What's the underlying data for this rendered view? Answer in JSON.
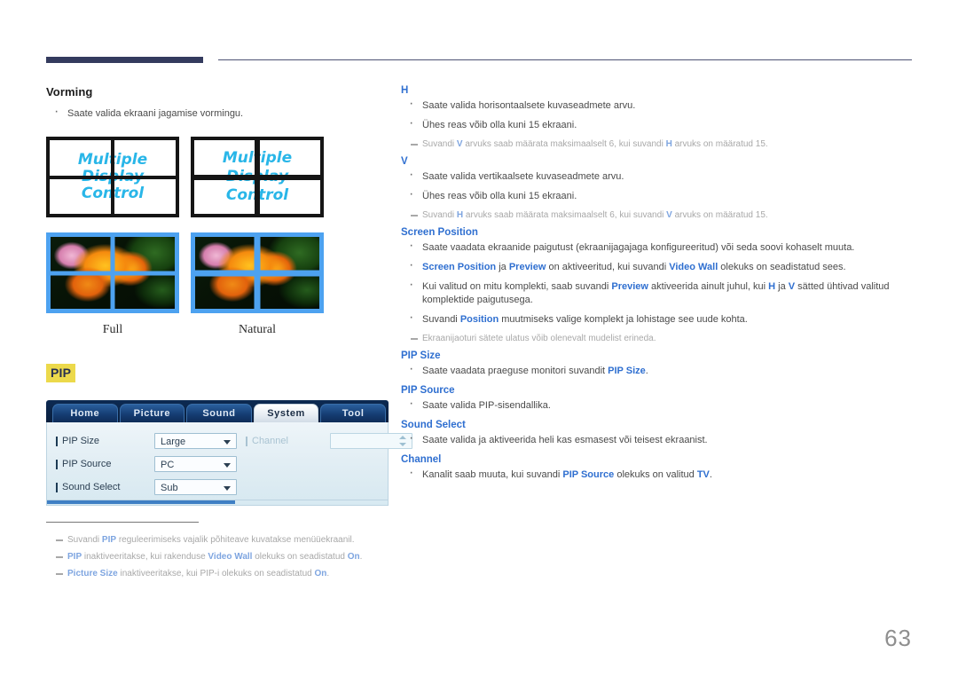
{
  "page": {
    "number": "63"
  },
  "left": {
    "vorming": {
      "heading": "Vorming",
      "bullets": [
        "Saate valida ekraani jagamise vormingu."
      ],
      "diagram": {
        "wall_text_lines": [
          "Multiple",
          "Display",
          "Control"
        ],
        "captions": [
          "Full",
          "Natural"
        ]
      }
    },
    "pip": {
      "badge": "PIP",
      "osd": {
        "tabs": [
          {
            "label": "Home",
            "active": false
          },
          {
            "label": "Picture",
            "active": false
          },
          {
            "label": "Sound",
            "active": false
          },
          {
            "label": "System",
            "active": true
          },
          {
            "label": "Tool",
            "active": false
          }
        ],
        "rows_left": [
          {
            "label": "PIP Size",
            "value": "Large"
          },
          {
            "label": "PIP Source",
            "value": "PC"
          },
          {
            "label": "Sound Select",
            "value": "Sub"
          }
        ],
        "rows_right": [
          {
            "label": "Channel",
            "value": ""
          }
        ]
      },
      "footnotes": [
        "Suvandi PIP reguleerimiseks vajalik põhiteave kuvatakse menüüekraanil.",
        "PIP inaktiveeritakse, kui rakenduse Video Wall olekuks on seadistatud On.",
        "Picture Size inaktiveeritakse, kui PIP-i olekuks on seadistatud On."
      ]
    }
  },
  "right": {
    "sections": [
      {
        "heading": "H",
        "bullets": [
          "Saate valida horisontaalsete kuvaseadmete arvu.",
          "Ühes reas võib olla kuni 15 ekraani."
        ],
        "notes": [
          "Suvandi V arvuks saab määrata maksimaalselt 6, kui suvandi H arvuks on määratud 15."
        ]
      },
      {
        "heading": "V",
        "bullets": [
          "Saate valida vertikaalsete kuvaseadmete arvu.",
          "Ühes reas võib olla kuni 15 ekraani."
        ],
        "notes": [
          "Suvandi H arvuks saab määrata maksimaalselt 6, kui suvandi V arvuks on määratud 15."
        ]
      },
      {
        "heading": "Screen Position",
        "bullets": [
          "Saate vaadata ekraanide paigutust (ekraanijagajaga konfigureeritud) või seda soovi kohaselt muuta.",
          "Screen Position ja Preview on aktiveeritud, kui suvandi Video Wall olekuks on seadistatud sees.",
          "Kui valitud on mitu komplekti, saab suvandi Preview aktiveerida ainult juhul, kui H ja V sätted ühtivad valitud komplektide paigutusega.",
          "Suvandi Position muutmiseks valige komplekt ja lohistage see uude kohta."
        ],
        "notes": [
          "Ekraanijaoturi sätete ulatus võib olenevalt mudelist erineda."
        ]
      },
      {
        "heading": "PIP Size",
        "bullets": [
          "Saate vaadata praeguse monitori suvandit PIP Size."
        ],
        "notes": []
      },
      {
        "heading": "PIP Source",
        "bullets": [
          "Saate valida PIP-sisendallika."
        ],
        "notes": []
      },
      {
        "heading": "Sound Select",
        "bullets": [
          "Saate valida ja aktiveerida heli kas esmasest või teisest ekraanist."
        ],
        "notes": []
      },
      {
        "heading": "Channel",
        "bullets": [
          "Kanalit saab muuta, kui suvandi PIP Source olekuks on valitud TV."
        ],
        "notes": []
      }
    ],
    "emphasis_terms": [
      "Screen Position",
      "Preview",
      "Video Wall",
      "Position",
      "PIP Size",
      "PIP Source",
      "Picture Size",
      "TV",
      "PIP",
      "On",
      "H",
      "V"
    ]
  },
  "colors": {
    "accent_blue": "#2f6fd0",
    "header_navy": "#343b5e",
    "badge_yellow": "#ecd94b",
    "wall_text_cyan": "#29b6e8",
    "photo_border_blue": "#4da2f0"
  }
}
